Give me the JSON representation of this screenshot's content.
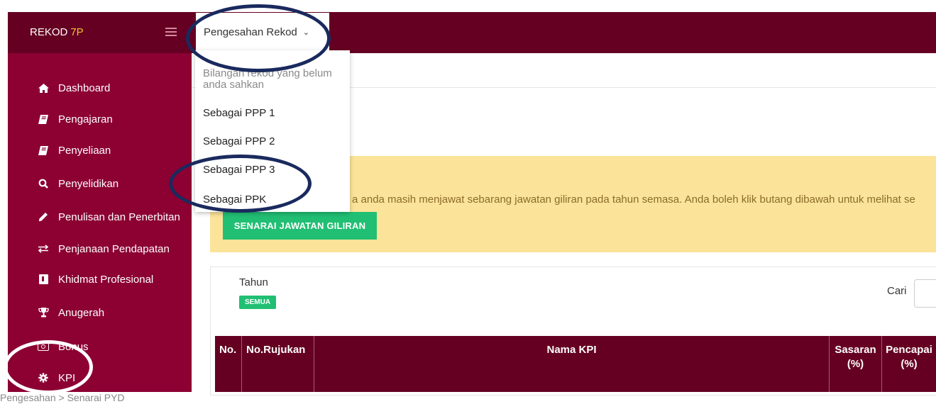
{
  "sidebar": {
    "brand_text": "REKOD",
    "brand_accent": "7P",
    "items": [
      {
        "label": "Dashboard",
        "icon": "home-icon"
      },
      {
        "label": "Pengajaran",
        "icon": "book-icon"
      },
      {
        "label": "Penyeliaan",
        "icon": "book-icon"
      },
      {
        "label": "Penyelidikan",
        "icon": "search-icon"
      },
      {
        "label": "Penulisan dan Penerbitan",
        "icon": "pencil-icon"
      },
      {
        "label": "Penjanaan Pendapatan",
        "icon": "exchange-icon"
      },
      {
        "label": "Khidmat Profesional",
        "icon": "hourglass-icon"
      },
      {
        "label": "Anugerah",
        "icon": "trophy-icon"
      },
      {
        "label": "Bonus",
        "icon": "money-icon"
      },
      {
        "label": "KPI",
        "icon": "gear-icon"
      }
    ]
  },
  "topbar": {
    "dropdown_label": "Pengesahan Rekod",
    "chevron": "⌄",
    "menu": {
      "header": "Bilangan rekod yang belum anda sahkan",
      "items": [
        "Sebagai PPP 1",
        "Sebagai PPP 2",
        "Sebagai PPP 3",
        "Sebagai PPK"
      ]
    }
  },
  "alert": {
    "text": "a anda masih menjawat sebarang jawatan giliran pada tahun semasa. Anda boleh klik butang dibawah untuk melihat se",
    "button_label": "SENARAI JAWATAN GILIRAN"
  },
  "filter": {
    "tahun_label": "Tahun",
    "tahun_badge": "SEMUA",
    "cari_label": "Cari"
  },
  "table": {
    "headers": [
      "No.",
      "No.Rujukan",
      "Nama KPI",
      "Sasaran (%)",
      "Pencapai (%)"
    ]
  },
  "footer_breadcrumb": "Pengesahan  >  Senarai PYD",
  "colors": {
    "sidebar": "#8c0032",
    "sidebar_header": "#650022",
    "topbar": "#650022",
    "accent_yellow": "#f5c02b",
    "button_green": "#21bf73",
    "alert_bg": "#fbe39a",
    "annotation_navy": "#1a2a5e"
  }
}
